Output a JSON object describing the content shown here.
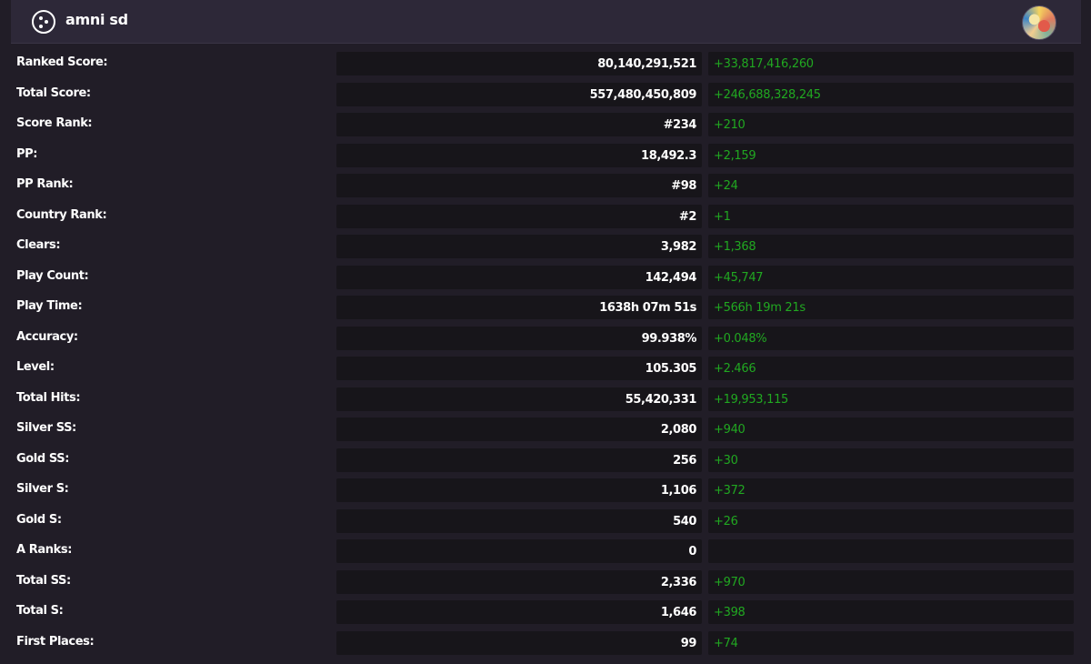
{
  "header": {
    "title": "amni sd",
    "logo_icon": "osu-logo-icon",
    "avatar_icon": "user-avatar-icon"
  },
  "colors": {
    "background": "#211d27",
    "header": "#2d2838",
    "cell": "#17151a",
    "positive_delta": "#21a821"
  },
  "stats": [
    {
      "label": "Ranked Score:",
      "value": "80,140,291,521",
      "delta": "+33,817,416,260"
    },
    {
      "label": "Total Score:",
      "value": "557,480,450,809",
      "delta": "+246,688,328,245"
    },
    {
      "label": "Score Rank:",
      "value": "#234",
      "delta": "+210"
    },
    {
      "label": "PP:",
      "value": "18,492.3",
      "delta": "+2,159"
    },
    {
      "label": "PP Rank:",
      "value": "#98",
      "delta": "+24"
    },
    {
      "label": "Country Rank:",
      "value": "#2",
      "delta": "+1"
    },
    {
      "label": "Clears:",
      "value": "3,982",
      "delta": "+1,368"
    },
    {
      "label": "Play Count:",
      "value": "142,494",
      "delta": "+45,747"
    },
    {
      "label": "Play Time:",
      "value": "1638h 07m 51s",
      "delta": "+566h 19m 21s"
    },
    {
      "label": "Accuracy:",
      "value": "99.938%",
      "delta": "+0.048%"
    },
    {
      "label": "Level:",
      "value": "105.305",
      "delta": "+2.466"
    },
    {
      "label": "Total Hits:",
      "value": "55,420,331",
      "delta": "+19,953,115"
    },
    {
      "label": "Silver SS:",
      "value": "2,080",
      "delta": "+940"
    },
    {
      "label": "Gold SS:",
      "value": "256",
      "delta": "+30"
    },
    {
      "label": "Silver S:",
      "value": "1,106",
      "delta": "+372"
    },
    {
      "label": "Gold S:",
      "value": "540",
      "delta": "+26"
    },
    {
      "label": "A Ranks:",
      "value": "0",
      "delta": ""
    },
    {
      "label": "Total SS:",
      "value": "2,336",
      "delta": "+970"
    },
    {
      "label": "Total S:",
      "value": "1,646",
      "delta": "+398"
    },
    {
      "label": "First Places:",
      "value": "99",
      "delta": "+74"
    }
  ]
}
